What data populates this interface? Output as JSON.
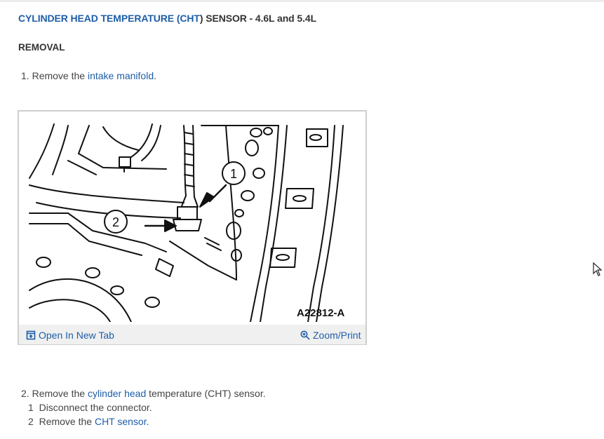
{
  "title": {
    "part1": "CYLINDER HEAD TEMPERATURE (",
    "part2": "CHT",
    "part3": ") SENSOR - 4.6L and 5.4L"
  },
  "section": "REMOVAL",
  "step1": {
    "num": "1.",
    "text": "Remove the",
    "link": "intake manifold",
    "end": "."
  },
  "figure": {
    "caption": "A22812-A",
    "callout1": "1",
    "callout2": "2",
    "open_label": "Open In New Tab",
    "zoom_label": "Zoom/Print",
    "open_icon": "open-in-new-tab-icon",
    "zoom_icon": "magnifier-zoom-icon"
  },
  "step2": {
    "num": "2.",
    "text1": "Remove the",
    "link": "cylinder head",
    "text2": "temperature (CHT) sensor."
  },
  "substeps": [
    {
      "num": "1",
      "text": "Disconnect the connector."
    },
    {
      "num": "2",
      "text": "Remove the",
      "link": "CHT sensor",
      "end": "."
    }
  ]
}
